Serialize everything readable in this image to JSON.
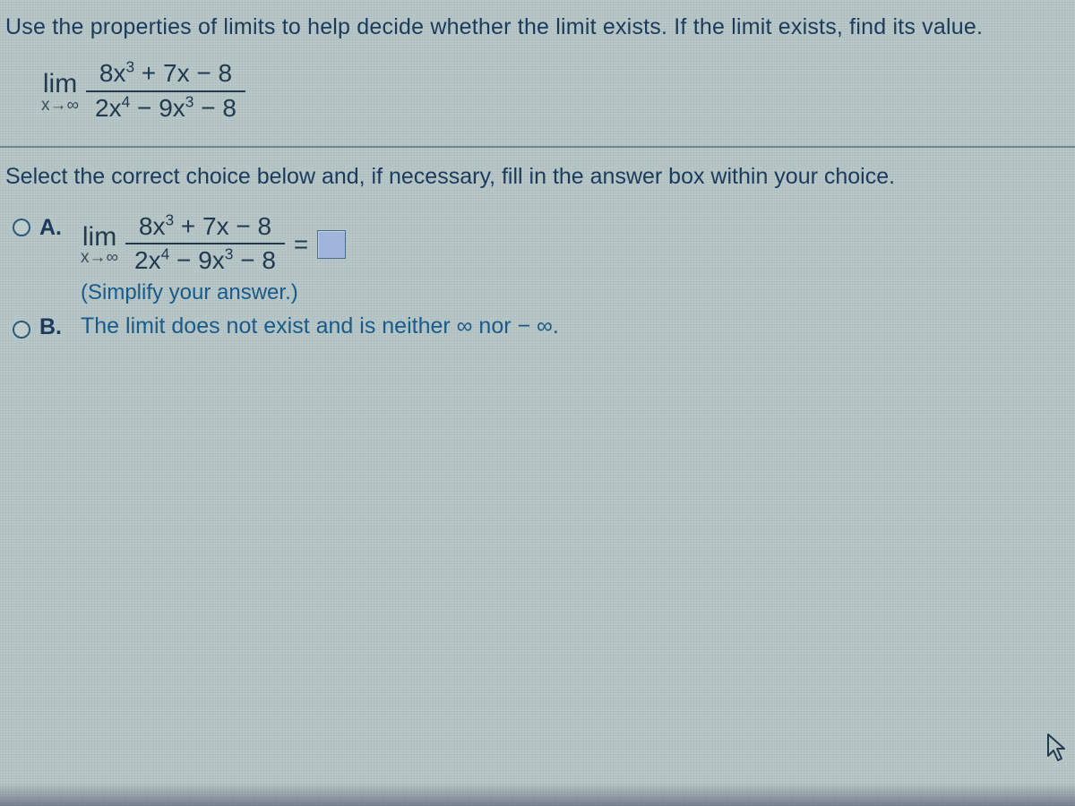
{
  "instruction": "Use the properties of limits to help decide whether the limit exists. If the limit exists, find its value.",
  "limit": {
    "lim_word": "lim",
    "lim_sub": "x→∞",
    "numerator_html": "8x<sup>3</sup> + 7x − 8",
    "denominator_html": "2x<sup>4</sup> − 9x<sup>3</sup> − 8"
  },
  "select_instruction": "Select the correct choice below and, if necessary, fill in the answer box within your choice.",
  "choices": {
    "a": {
      "letter": "A.",
      "lim_word": "lim",
      "lim_sub": "x→∞",
      "numerator_html": "8x<sup>3</sup> + 7x − 8",
      "denominator_html": "2x<sup>4</sup> − 9x<sup>3</sup> − 8",
      "equals": "=",
      "simplify": "(Simplify your answer.)"
    },
    "b": {
      "letter": "B.",
      "text": "The limit does not exist and is neither ∞ nor − ∞."
    }
  }
}
